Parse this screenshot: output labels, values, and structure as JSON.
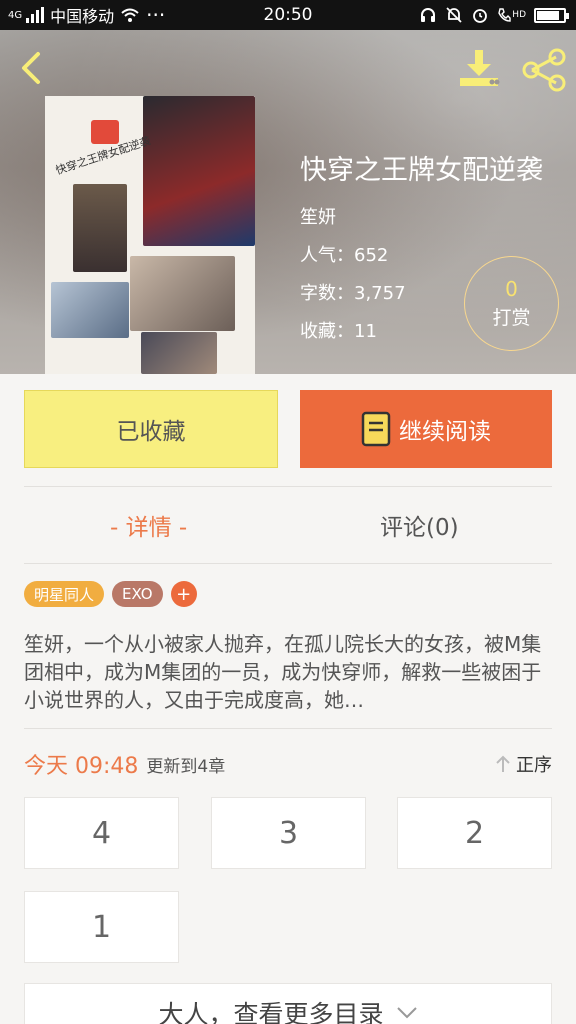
{
  "status_bar": {
    "network": "4G",
    "carrier": "中国移动",
    "dots": "···",
    "time": "20:50",
    "hd_label": "HD"
  },
  "book": {
    "title": "快穿之王牌女配逆袭",
    "author": "笙妍",
    "popularity": "人气：652",
    "word_count": "字数：3,757",
    "favorites": "收藏：11",
    "cover_text": "快穿之王牌女配逆袭"
  },
  "tip": {
    "count": "0",
    "label": "打赏"
  },
  "actions": {
    "collected": "已收藏",
    "continue_reading": "继续阅读"
  },
  "tabs": {
    "detail": "- 详情 -",
    "comments": "评论(0)"
  },
  "tags": [
    "明星同人",
    "EXO",
    "+"
  ],
  "synopsis": "笙妍，一个从小被家人抛弃，在孤儿院长大的女孩，被M集团相中，成为M集团的一员，成为快穿师，解救一些被困于小说世界的人，又由于完成度高，她…",
  "update": {
    "time": "今天 09:48",
    "chapter": "更新到4章",
    "sort_label": "正序"
  },
  "chapters": [
    "4",
    "3",
    "2",
    "1"
  ],
  "more_label": "大人，查看更多目录",
  "colors": {
    "accent": "#ec6a3c",
    "collected_bg": "#f8ef80",
    "tab_active": "#ec7a4a",
    "icon_yellow": "#f8ee78"
  }
}
